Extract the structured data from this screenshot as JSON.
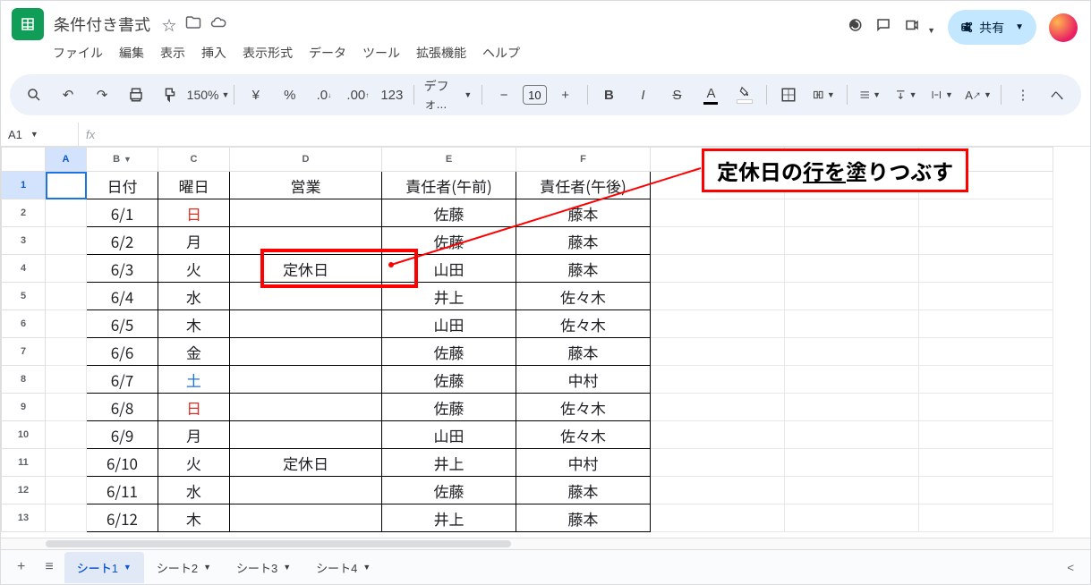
{
  "title": "条件付き書式",
  "menus": [
    "ファイル",
    "編集",
    "表示",
    "挿入",
    "表示形式",
    "データ",
    "ツール",
    "拡張機能",
    "ヘルプ"
  ],
  "share_label": "共有",
  "toolbar": {
    "zoom": "150%",
    "font": "デフォ...",
    "font_size": "10"
  },
  "namebox": "A1",
  "formula": "",
  "columns": [
    {
      "id": "A",
      "w": 46,
      "selected": true
    },
    {
      "id": "B",
      "w": 80,
      "dropdown": true
    },
    {
      "id": "C",
      "w": 80
    },
    {
      "id": "D",
      "w": 170
    },
    {
      "id": "E",
      "w": 150
    },
    {
      "id": "F",
      "w": 150
    },
    {
      "id": "",
      "w": 150
    },
    {
      "id": "",
      "w": 150
    },
    {
      "id": "",
      "w": 150
    }
  ],
  "headers": {
    "B": "日付",
    "C": "曜日",
    "D": "営業",
    "E": "責任者(午前)",
    "F": "責任者(午後)"
  },
  "rows": [
    {
      "n": 1,
      "selected": true
    },
    {
      "n": 2,
      "B": "6/1",
      "C": "日",
      "Cclass": "sunday",
      "E": "佐藤",
      "F": "藤本"
    },
    {
      "n": 3,
      "B": "6/2",
      "C": "月",
      "E": "佐藤",
      "F": "藤本"
    },
    {
      "n": 4,
      "B": "6/3",
      "C": "火",
      "D": "定休日",
      "E": "山田",
      "F": "藤本"
    },
    {
      "n": 5,
      "B": "6/4",
      "C": "水",
      "E": "井上",
      "F": "佐々木"
    },
    {
      "n": 6,
      "B": "6/5",
      "C": "木",
      "E": "山田",
      "F": "佐々木"
    },
    {
      "n": 7,
      "B": "6/6",
      "C": "金",
      "E": "佐藤",
      "F": "藤本"
    },
    {
      "n": 8,
      "B": "6/7",
      "C": "土",
      "Cclass": "saturday",
      "E": "佐藤",
      "F": "中村"
    },
    {
      "n": 9,
      "B": "6/8",
      "C": "日",
      "Cclass": "sunday",
      "E": "佐藤",
      "F": "佐々木"
    },
    {
      "n": 10,
      "B": "6/9",
      "C": "月",
      "E": "山田",
      "F": "佐々木"
    },
    {
      "n": 11,
      "B": "6/10",
      "C": "火",
      "D": "定休日",
      "E": "井上",
      "F": "中村"
    },
    {
      "n": 12,
      "B": "6/11",
      "C": "水",
      "E": "佐藤",
      "F": "藤本"
    },
    {
      "n": 13,
      "B": "6/12",
      "C": "木",
      "E": "井上",
      "F": "藤本"
    }
  ],
  "tabs": [
    {
      "label": "シート1",
      "active": true
    },
    {
      "label": "シート2"
    },
    {
      "label": "シート3"
    },
    {
      "label": "シート4"
    }
  ],
  "callout": {
    "pre": "定休日の",
    "ul": "行を",
    "post": "塗りつぶす"
  }
}
